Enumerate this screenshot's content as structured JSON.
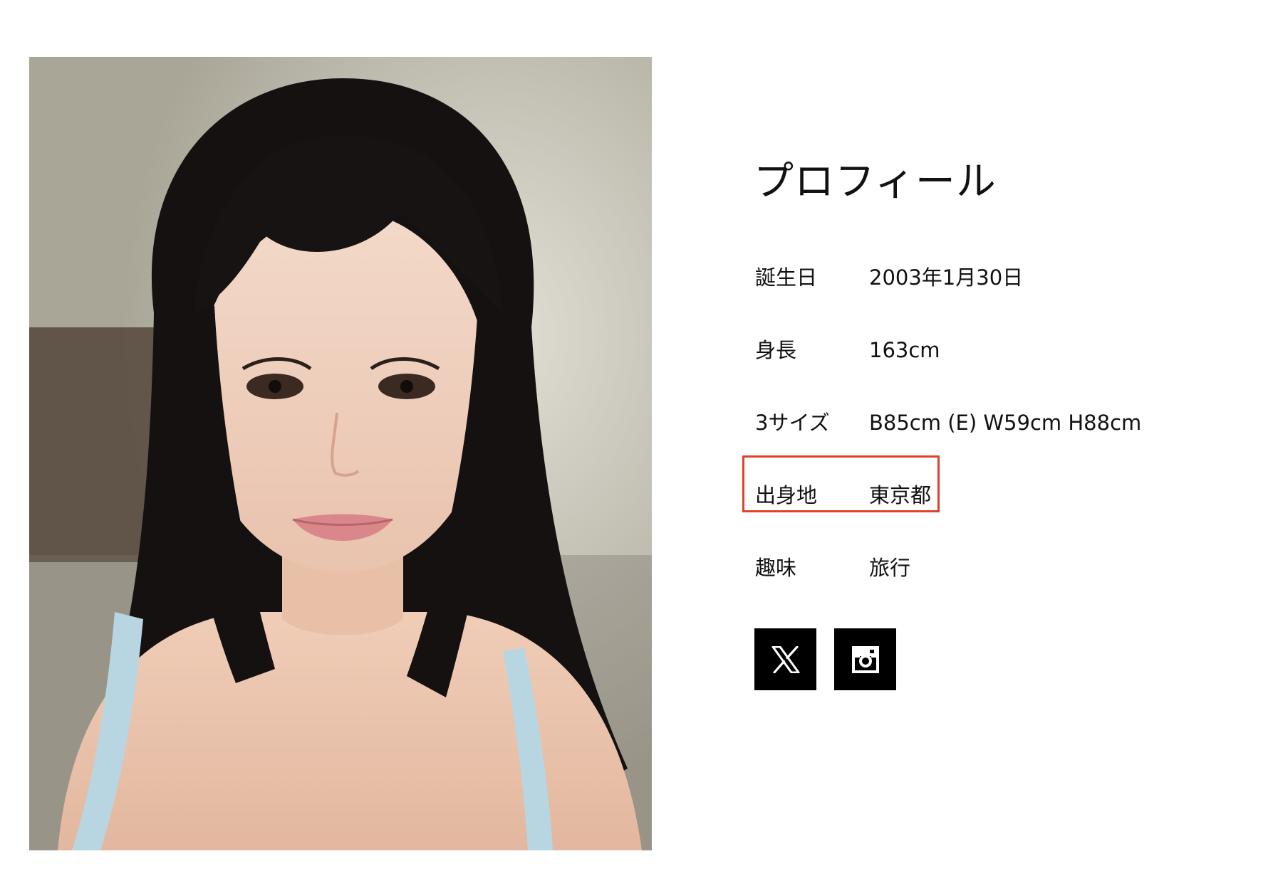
{
  "photo": {
    "alt": "プロフィール写真"
  },
  "profile": {
    "title": "プロフィール",
    "rows": [
      {
        "label": "誕生日",
        "value": "2003年1月30日"
      },
      {
        "label": "身長",
        "value": "163cm"
      },
      {
        "label": "3サイズ",
        "value": "B85cm (E) W59cm H88cm"
      },
      {
        "label": "出身地",
        "value": "東京都"
      },
      {
        "label": "趣味",
        "value": "旅行"
      }
    ],
    "highlight_row": "出身地"
  },
  "socials": [
    {
      "icon": "x-icon",
      "service": "X"
    },
    {
      "icon": "instagram-icon",
      "service": "Instagram"
    }
  ],
  "colors": {
    "background": "#ffffff",
    "text": "#111111",
    "highlight_border": "#e0412b",
    "social_button": "#000000"
  }
}
